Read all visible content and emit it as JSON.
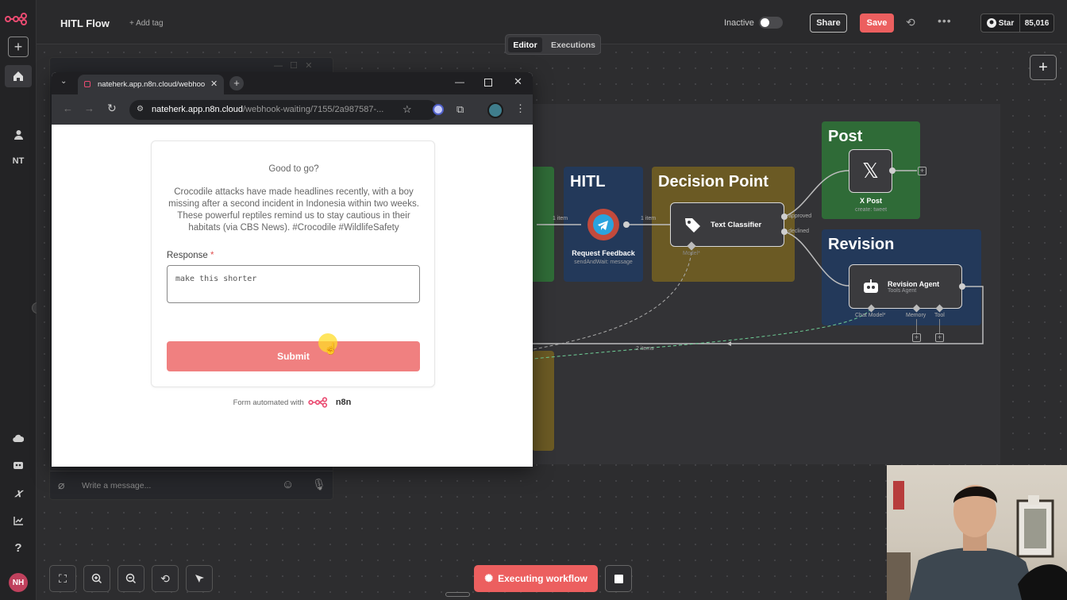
{
  "app": {
    "workflow_title": "HITL Flow",
    "add_tag": "+ Add tag",
    "status_label": "Inactive",
    "share_label": "Share",
    "save_label": "Save",
    "github_star_label": "Star",
    "github_star_count": "85,016",
    "tabs": [
      {
        "label": "Editor",
        "active": true
      },
      {
        "label": "Executions",
        "active": false
      }
    ],
    "user_initials_side": "NT",
    "user_avatar_initials": "NH"
  },
  "colors": {
    "accent": "#ec5f5f",
    "post_sticky": "#2f6b37",
    "hitl_sticky": "#23395a",
    "decision_sticky": "#6b5a24",
    "revision_sticky": "#23395a"
  },
  "workflow": {
    "stickies": {
      "hitl": "HITL",
      "decision": "Decision Point",
      "post": "Post",
      "revision": "Revision"
    },
    "nodes": {
      "request_feedback": {
        "label": "Request Feedback",
        "sub": "sendAndWait: message",
        "icon": "telegram-icon"
      },
      "text_classifier": {
        "label": "Text Classifier",
        "icon": "tag-icon",
        "port_model": "Model*"
      },
      "x_post": {
        "label": "X Post",
        "sub": "create: tweet",
        "icon": "x-logo-icon"
      },
      "revision_agent": {
        "label": "Revision Agent",
        "sub": "Tools Agent",
        "icon": "robot-icon",
        "ports": [
          "Chat Model*",
          "Memory",
          "Tool"
        ]
      }
    },
    "edge_labels": {
      "one_item_a": "1 item",
      "one_item_b": "1 item",
      "approved": "approved",
      "declined": "declined",
      "two_items": "2 items"
    }
  },
  "chat": {
    "placeholder": "Write a message..."
  },
  "browser": {
    "tab_title": "nateherk.app.n8n.cloud/webhoo",
    "url_host": "nateherk.app.n8n.cloud",
    "url_path": "/webhook-waiting/7155/2a987587-..."
  },
  "form": {
    "heading": "Good to go?",
    "message": "Crocodile attacks have made headlines recently, with a boy missing after a second incident in Indonesia within two weeks. These powerful reptiles remind us to stay cautious in their habitats (via CBS News). #Crocodile #WildlifeSafety",
    "response_label": "Response",
    "required_mark": "*",
    "response_value": "make this shorter",
    "submit_label": "Submit",
    "footer_prefix": "Form automated with",
    "footer_brand": "n8n"
  },
  "toolbar": {
    "executing_label": "Executing workflow"
  }
}
